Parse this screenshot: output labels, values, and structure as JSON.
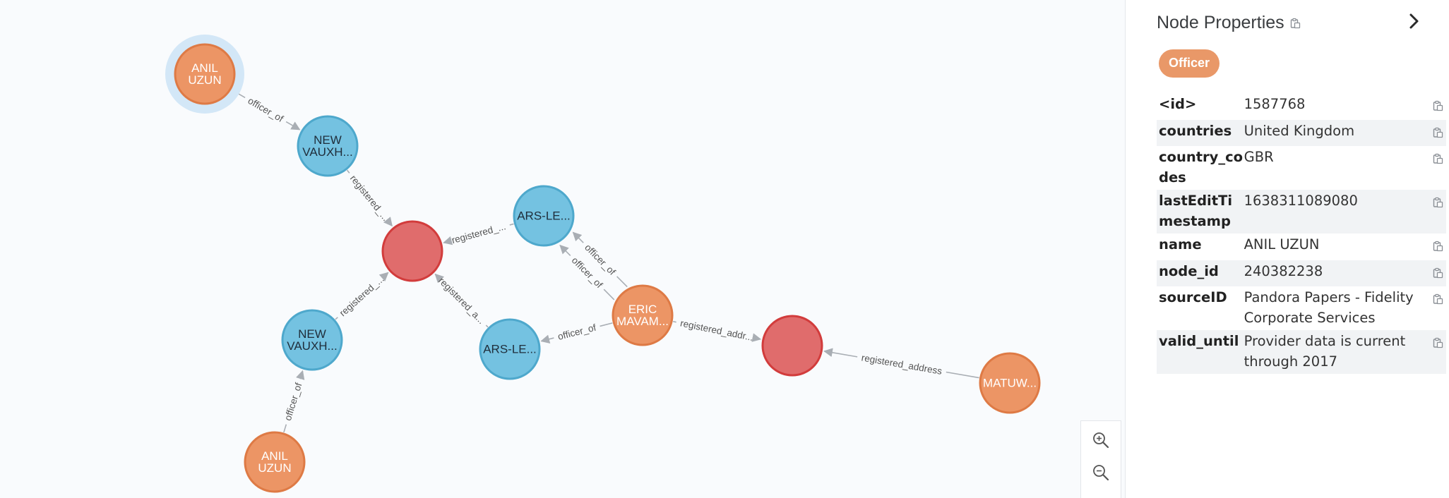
{
  "panel": {
    "title": "Node Properties",
    "badge": "Officer",
    "properties": [
      {
        "key": "<id>",
        "value": "1587768"
      },
      {
        "key": "countries",
        "value": "United Kingdom"
      },
      {
        "key": "country_codes",
        "value": "GBR"
      },
      {
        "key": "lastEditTimestamp",
        "value": "1638311089080"
      },
      {
        "key": "name",
        "value": "ANIL UZUN"
      },
      {
        "key": "node_id",
        "value": "240382238"
      },
      {
        "key": "sourceID",
        "value": "Pandora Papers - Fidelity Corporate Services"
      },
      {
        "key": "valid_until",
        "value": "Provider data is current through 2017"
      }
    ]
  },
  "graph": {
    "nodes": [
      {
        "id": "n1",
        "type": "officer",
        "lines": [
          "ANIL",
          "UZUN"
        ],
        "selected": true
      },
      {
        "id": "n2",
        "type": "entity",
        "lines": [
          "NEW",
          "VAUXH..."
        ]
      },
      {
        "id": "n3",
        "type": "address",
        "lines": []
      },
      {
        "id": "n4",
        "type": "entity",
        "lines": [
          "ARS-LE..."
        ]
      },
      {
        "id": "n5",
        "type": "entity",
        "lines": [
          "NEW",
          "VAUXH..."
        ]
      },
      {
        "id": "n6",
        "type": "entity",
        "lines": [
          "ARS-LE..."
        ]
      },
      {
        "id": "n7",
        "type": "officer",
        "lines": [
          "ERIC",
          "MAVAM..."
        ]
      },
      {
        "id": "n8",
        "type": "address",
        "lines": []
      },
      {
        "id": "n9",
        "type": "officer",
        "lines": [
          "MATUW..."
        ]
      },
      {
        "id": "n10",
        "type": "officer",
        "lines": [
          "ANIL",
          "UZUN"
        ]
      }
    ],
    "edges": [
      {
        "from": "n1",
        "to": "n2",
        "label": "officer_of"
      },
      {
        "from": "n2",
        "to": "n3",
        "label": "registered_..."
      },
      {
        "from": "n4",
        "to": "n3",
        "label": "registered_..."
      },
      {
        "from": "n5",
        "to": "n3",
        "label": "registered_..."
      },
      {
        "from": "n6",
        "to": "n3",
        "label": "registered_a..."
      },
      {
        "from": "n7",
        "to": "n4",
        "label": "officer_of"
      },
      {
        "from": "n7",
        "to": "n4",
        "label": "officer_of"
      },
      {
        "from": "n7",
        "to": "n6",
        "label": "officer_of"
      },
      {
        "from": "n7",
        "to": "n8",
        "label": "registered_addr..."
      },
      {
        "from": "n9",
        "to": "n8",
        "label": "registered_address"
      },
      {
        "from": "n10",
        "to": "n5",
        "label": "officer_of"
      }
    ],
    "colors": {
      "officer": "#ec9565",
      "officer_stroke": "#de7a45",
      "entity": "#74c2e1",
      "entity_stroke": "#4ea8cc",
      "address": "#e06c6c",
      "address_stroke": "#d23c3c",
      "selection_halo": "#d3e7f7",
      "edge": "#a9aeb4"
    }
  },
  "zoom": {
    "in_icon": "zoom-in-icon",
    "out_icon": "zoom-out-icon"
  }
}
